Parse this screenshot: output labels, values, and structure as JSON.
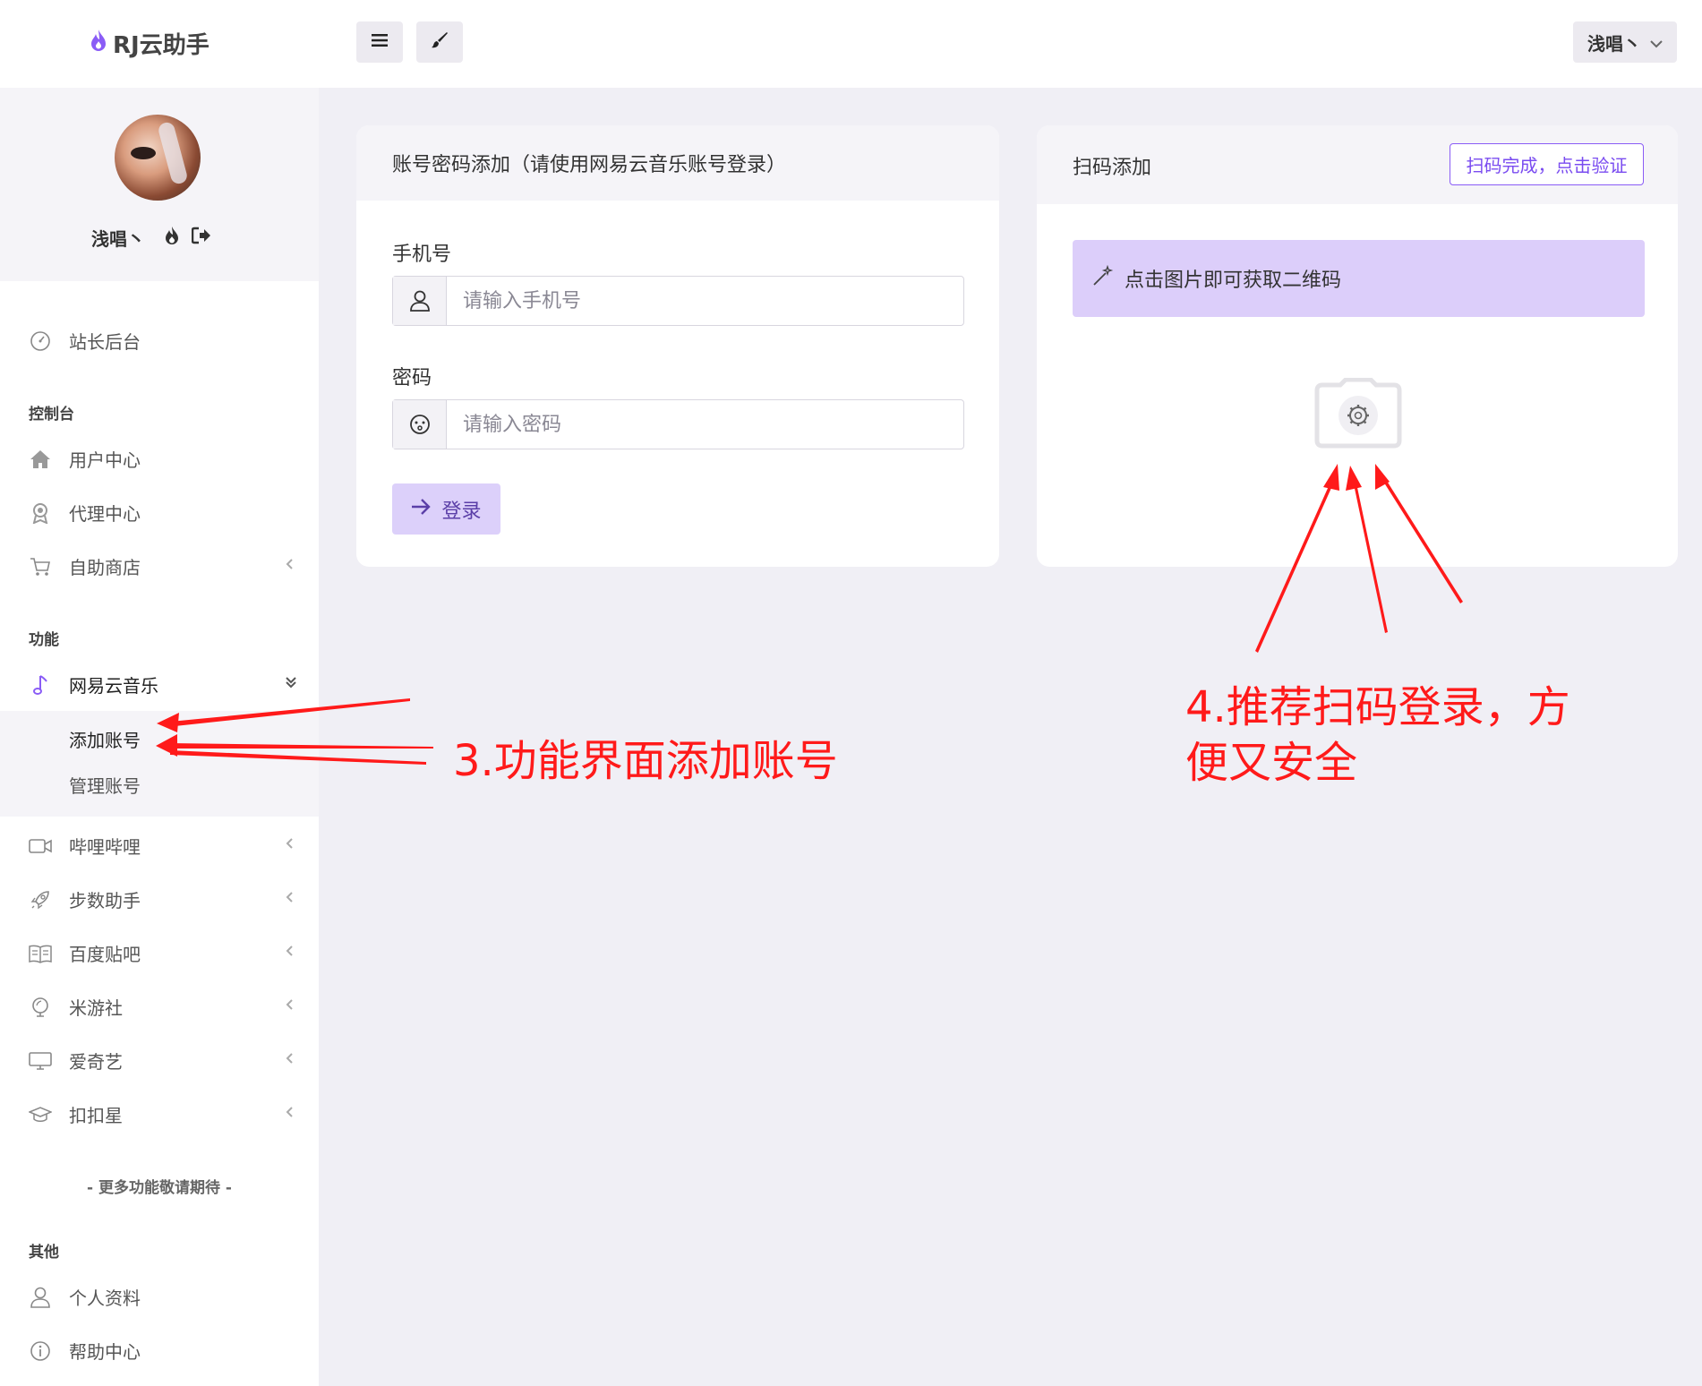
{
  "header": {
    "logo_text": "RJ云助手",
    "menu_icon": "menu-icon",
    "theme_icon": "brush-icon",
    "user_name": "浅唱丶"
  },
  "profile": {
    "name": "浅唱丶"
  },
  "sidebar": {
    "admin": "站长后台",
    "section_console": "控制台",
    "user_center": "用户中心",
    "agent_center": "代理中心",
    "self_shop": "自助商店",
    "section_features": "功能",
    "netease_music": "网易云音乐",
    "add_account": "添加账号",
    "manage_account": "管理账号",
    "bilibili": "哔哩哔哩",
    "step_helper": "步数助手",
    "baidu_tieba": "百度贴吧",
    "miyoushe": "米游社",
    "iqiyi": "爱奇艺",
    "koukouxing": "扣扣星",
    "more_note": "- 更多功能敬请期待 -",
    "section_other": "其他",
    "profile": "个人资料",
    "help_center": "帮助中心"
  },
  "password_card": {
    "title": "账号密码添加（请使用网易云音乐账号登录）",
    "phone_label": "手机号",
    "phone_placeholder": "请输入手机号",
    "password_label": "密码",
    "password_placeholder": "请输入密码",
    "login_button": "登录"
  },
  "qr_card": {
    "title": "扫码添加",
    "verify_button": "扫码完成，点击验证",
    "tip": "点击图片即可获取二维码"
  },
  "annotations": {
    "note3": "3.功能界面添加账号",
    "note4_line1": "4.推荐扫码登录，方",
    "note4_line2": "便又安全"
  },
  "colors": {
    "accent": "#7a4cf0",
    "alert_bg": "#dccefa",
    "annotation": "#ff1a1a"
  }
}
